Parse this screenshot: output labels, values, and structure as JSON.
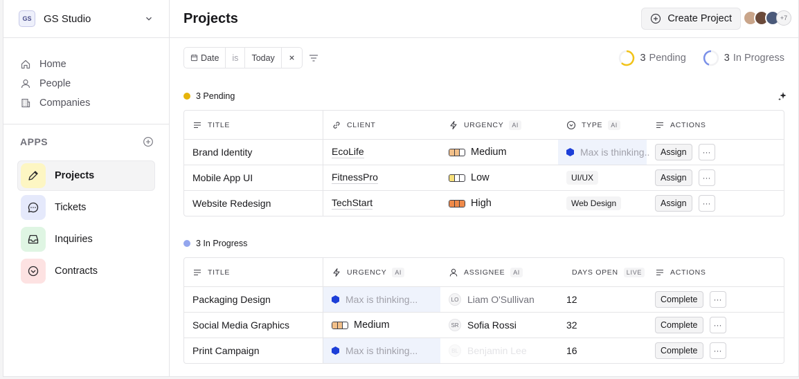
{
  "workspace": {
    "initials": "GS",
    "name": "GS Studio"
  },
  "nav": [
    {
      "label": "Home",
      "icon": "home-icon"
    },
    {
      "label": "People",
      "icon": "person-icon"
    },
    {
      "label": "Companies",
      "icon": "building-icon"
    }
  ],
  "apps": {
    "title": "APPS",
    "items": [
      {
        "label": "Projects",
        "icon": "pencil-icon",
        "color": "#fdf6c3"
      },
      {
        "label": "Tickets",
        "icon": "chat-icon",
        "color": "#e5e9fb"
      },
      {
        "label": "Inquiries",
        "icon": "inbox-icon",
        "color": "#dff5e3"
      },
      {
        "label": "Contracts",
        "icon": "check-circle-icon",
        "color": "#fde2e2"
      }
    ]
  },
  "header": {
    "title": "Projects",
    "create_label": "Create Project",
    "more_avatars": "+7"
  },
  "filter": {
    "field": "Date",
    "op": "is",
    "value": "Today"
  },
  "summary": {
    "pending_count": "3",
    "pending_label": "Pending",
    "progress_count": "3",
    "progress_label": "In Progress"
  },
  "pending": {
    "label": "3 Pending",
    "color": "#e6b40b",
    "columns": [
      "TITLE",
      "CLIENT",
      "URGENCY",
      "TYPE",
      "ACTIONS"
    ],
    "ai_tag": "AI",
    "rows": [
      {
        "title": "Brand Identity",
        "client": "EcoLife",
        "urgency": "Medium",
        "type": "Max is thinking...",
        "action": "Assign"
      },
      {
        "title": "Mobile App UI",
        "client": "FitnessPro",
        "urgency": "Low",
        "type": "UI/UX",
        "action": "Assign"
      },
      {
        "title": "Website Redesign",
        "client": "TechStart",
        "urgency": "High",
        "type": "Web Design",
        "action": "Assign"
      }
    ]
  },
  "in_progress": {
    "label": "3 In Progress",
    "color": "#93a6ee",
    "columns": [
      "TITLE",
      "URGENCY",
      "ASSIGNEE",
      "DAYS OPEN",
      "ACTIONS"
    ],
    "live_tag": "LIVE",
    "rows": [
      {
        "title": "Packaging Design",
        "urgency": "Max is thinking...",
        "initials": "LO",
        "assignee": "Liam O'Sullivan",
        "days": "12",
        "action": "Complete"
      },
      {
        "title": "Social Media Graphics",
        "urgency": "Medium",
        "initials": "SR",
        "assignee": "Sofia Rossi",
        "days": "32",
        "action": "Complete"
      },
      {
        "title": "Print Campaign",
        "urgency": "Max is thinking...",
        "initials": "BL",
        "assignee": "Benjamin Lee",
        "days": "16",
        "action": "Complete"
      }
    ]
  },
  "more_glyph": "···"
}
